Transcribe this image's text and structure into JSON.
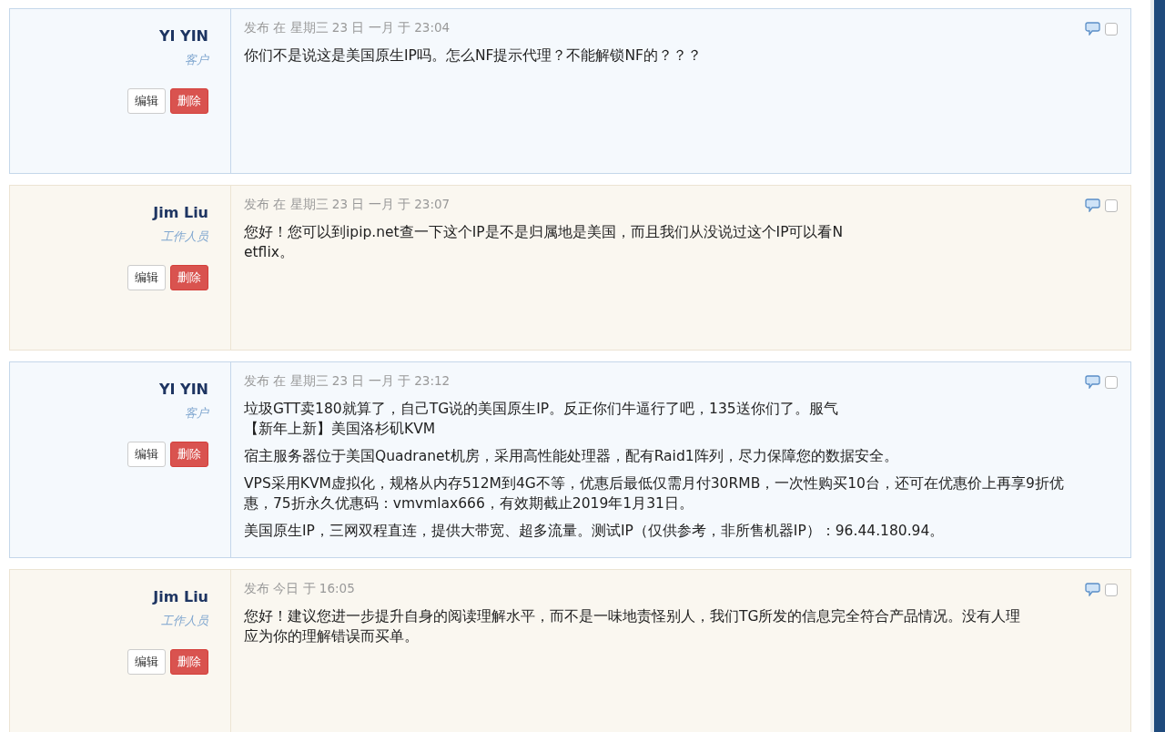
{
  "posts": [
    {
      "kind": "client",
      "author": "YI YIN",
      "role": "客户",
      "edit": "编辑",
      "delete": "删除",
      "meta": "发布 在 星期三 23 日 一月 于 23:04",
      "paragraphs": [
        [
          "你们不是说这是美国原生IP吗。怎么NF提示代理？不能解锁NF的？？？"
        ]
      ],
      "checked": false
    },
    {
      "kind": "staff",
      "author": "Jim Liu",
      "role": "工作人员",
      "edit": "编辑",
      "delete": "删除",
      "meta": "发布 在 星期三 23 日 一月 于 23:07",
      "paragraphs": [
        [
          "您好！您可以到ipip.net查一下这个IP是不是归属地是美国，而且我们从没说过这个IP可以看N",
          "etflix。"
        ]
      ],
      "checked": false
    },
    {
      "kind": "client",
      "author": "YI YIN",
      "role": "客户",
      "edit": "编辑",
      "delete": "删除",
      "meta": "发布 在 星期三 23 日 一月 于 23:12",
      "paragraphs": [
        [
          "垃圾GTT卖180就算了，自己TG说的美国原生IP。反正你们牛逼行了吧，135送你们了。服气",
          "【新年上新】美国洛杉矶KVM"
        ],
        [
          "宿主服务器位于美国Quadranet机房，采用高性能处理器，配有Raid1阵列，尽力保障您的数据安全。"
        ],
        [
          "VPS采用KVM虚拟化，规格从内存512M到4G不等，优惠后最低仅需月付30RMB，一次性购买10台，还可在优惠价上再享9折优",
          "惠，75折永久优惠码：vmvmlax666，有效期截止2019年1月31日。"
        ],
        [
          "美国原生IP，三网双程直连，提供大带宽、超多流量。测试IP（仅供参考，非所售机器IP）：96.44.180.94。"
        ]
      ],
      "checked": false
    },
    {
      "kind": "staff",
      "author": "Jim Liu",
      "role": "工作人员",
      "edit": "编辑",
      "delete": "删除",
      "meta": "发布 今日 于 16:05",
      "paragraphs": [
        [
          "您好！建议您进一步提升自身的阅读理解水平，而不是一味地责怪别人，我们TG所发的信息完全符合产品情况。没有人理",
          "应为你的理解错误而买单。"
        ]
      ],
      "checked": false
    }
  ]
}
